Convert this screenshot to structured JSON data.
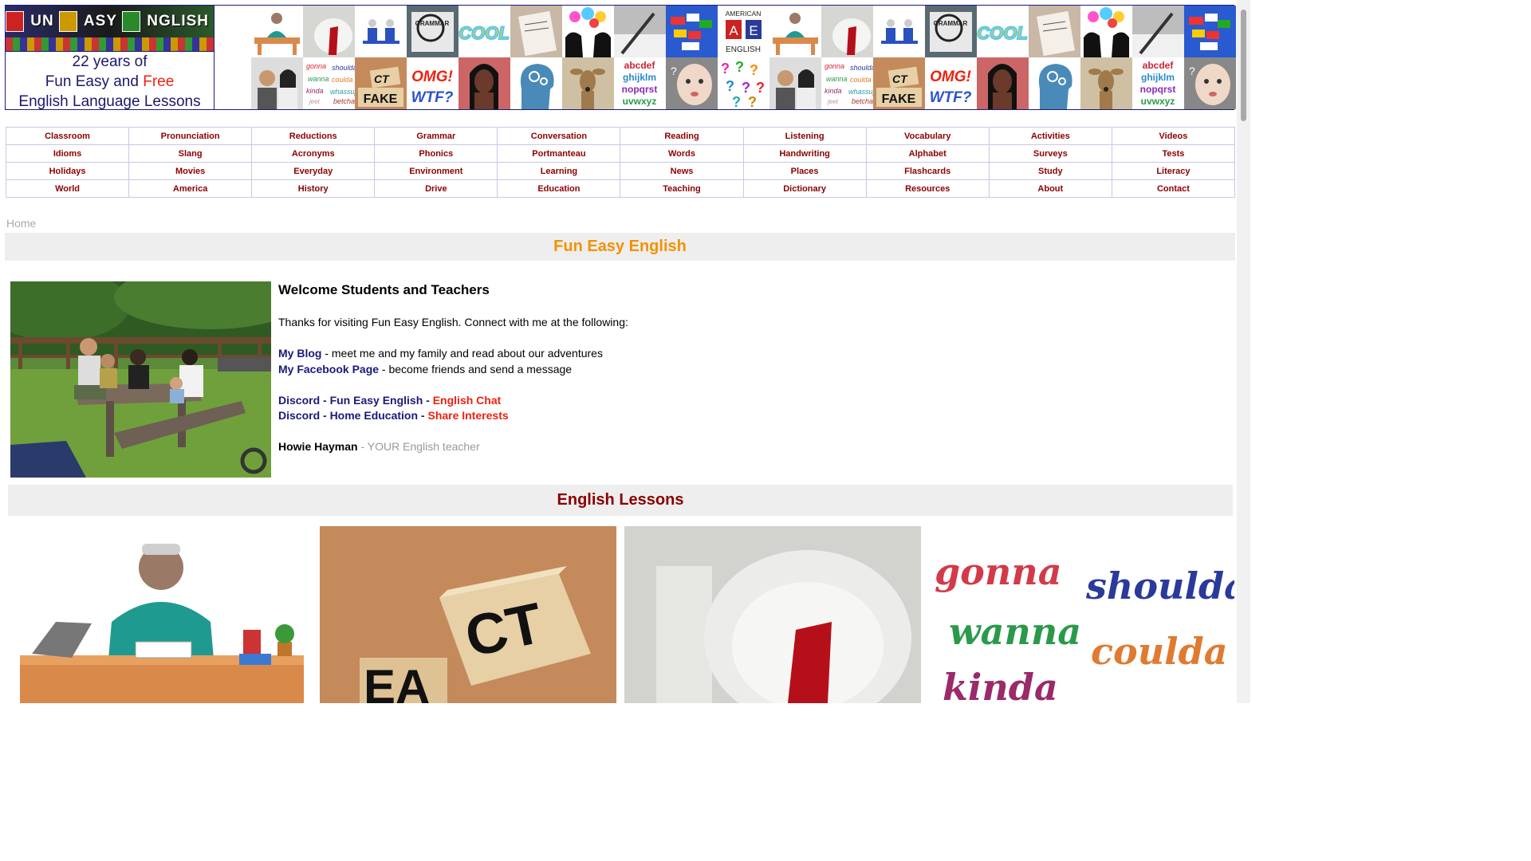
{
  "logo": {
    "title_words": [
      "UN",
      "ASY",
      "NGLISH"
    ],
    "line1": "22 years of",
    "line2_a": "Fun Easy and ",
    "line2_b": "Free",
    "line3": "English Language Lessons"
  },
  "banner_tiles": {
    "top": [
      {
        "kind": "teacher"
      },
      {
        "kind": "toilet"
      },
      {
        "kind": "figures"
      },
      {
        "kind": "grammar",
        "text": "GRAMMAR"
      },
      {
        "kind": "cool",
        "text": "COOL"
      },
      {
        "kind": "writing"
      },
      {
        "kind": "heads"
      },
      {
        "kind": "pen"
      },
      {
        "kind": "globe"
      },
      {
        "kind": "ae",
        "text1": "AMERICAN",
        "text2": "A E",
        "text3": "ENGLISH"
      },
      {
        "kind": "teacher"
      },
      {
        "kind": "toilet"
      },
      {
        "kind": "figures"
      },
      {
        "kind": "grammar",
        "text": "GRAMMAR"
      },
      {
        "kind": "cool",
        "text": "COOL"
      },
      {
        "kind": "writing"
      },
      {
        "kind": "heads"
      },
      {
        "kind": "pen"
      },
      {
        "kind": "globe"
      }
    ],
    "bottom": [
      {
        "kind": "couple"
      },
      {
        "kind": "slang",
        "text": "gonna wanna kinda jeet shoulda coulda whassup betcha"
      },
      {
        "kind": "fake",
        "text": "FAKE"
      },
      {
        "kind": "omg",
        "text": "OMG! WTF?"
      },
      {
        "kind": "woman"
      },
      {
        "kind": "brain"
      },
      {
        "kind": "deer"
      },
      {
        "kind": "abc",
        "text": "abcdef ghijklm nopqrst uvwxyz"
      },
      {
        "kind": "baby"
      },
      {
        "kind": "questions",
        "text": "???"
      },
      {
        "kind": "couple"
      },
      {
        "kind": "slang",
        "text": "gonna wanna kinda jeet shoulda coulda whassup betcha"
      },
      {
        "kind": "fake",
        "text": "FAKE"
      },
      {
        "kind": "omg",
        "text": "OMG! WTF?"
      },
      {
        "kind": "woman"
      },
      {
        "kind": "brain"
      },
      {
        "kind": "deer"
      },
      {
        "kind": "abc",
        "text": "abcdef ghijklm nopqrst uvwxyz"
      },
      {
        "kind": "baby"
      }
    ]
  },
  "nav_rows": [
    [
      "Classroom",
      "Pronunciation",
      "Reductions",
      "Grammar",
      "Conversation",
      "Reading",
      "Listening",
      "Vocabulary",
      "Activities",
      "Videos"
    ],
    [
      "Idioms",
      "Slang",
      "Acronyms",
      "Phonics",
      "Portmanteau",
      "Words",
      "Handwriting",
      "Alphabet",
      "Surveys",
      "Tests"
    ],
    [
      "Holidays",
      "Movies",
      "Everyday",
      "Environment",
      "Learning",
      "News",
      "Places",
      "Flashcards",
      "Study",
      "Literacy"
    ],
    [
      "World",
      "America",
      "History",
      "Drive",
      "Education",
      "Teaching",
      "Dictionary",
      "Resources",
      "About",
      "Contact"
    ]
  ],
  "breadcrumb": "Home",
  "page_title": "Fun Easy English",
  "welcome": {
    "heading": "Welcome Students and Teachers",
    "intro": "Thanks for visiting Fun Easy English. Connect with me at the following:",
    "blog_link": "My Blog",
    "blog_text": " - meet me and my family and read about our adventures",
    "fb_link": "My Facebook Page",
    "fb_text": " - become friends and send a message",
    "discord1_link": "Discord - Fun Easy English",
    "discord1_sep": " - ",
    "discord1_red": "English Chat",
    "discord2_link": "Discord - Home Education",
    "discord2_sep": " - ",
    "discord2_red": "Share Interests",
    "signature_name": "Howie Hayman",
    "signature_role": " - YOUR English teacher"
  },
  "lessons_title": "English Lessons",
  "lesson_cards": [
    {
      "label": "classroom"
    },
    {
      "label": "fact-fake",
      "text": "CT"
    },
    {
      "label": "toilet"
    },
    {
      "label": "reductions",
      "words": [
        "gonna",
        "shoulda",
        "wanna",
        "coulda",
        "kinda"
      ]
    }
  ],
  "colors": {
    "nav_text": "#8b0000",
    "title_orange": "#f39100",
    "link_blue": "#1a1a7a",
    "accent_red": "#ee2211"
  }
}
